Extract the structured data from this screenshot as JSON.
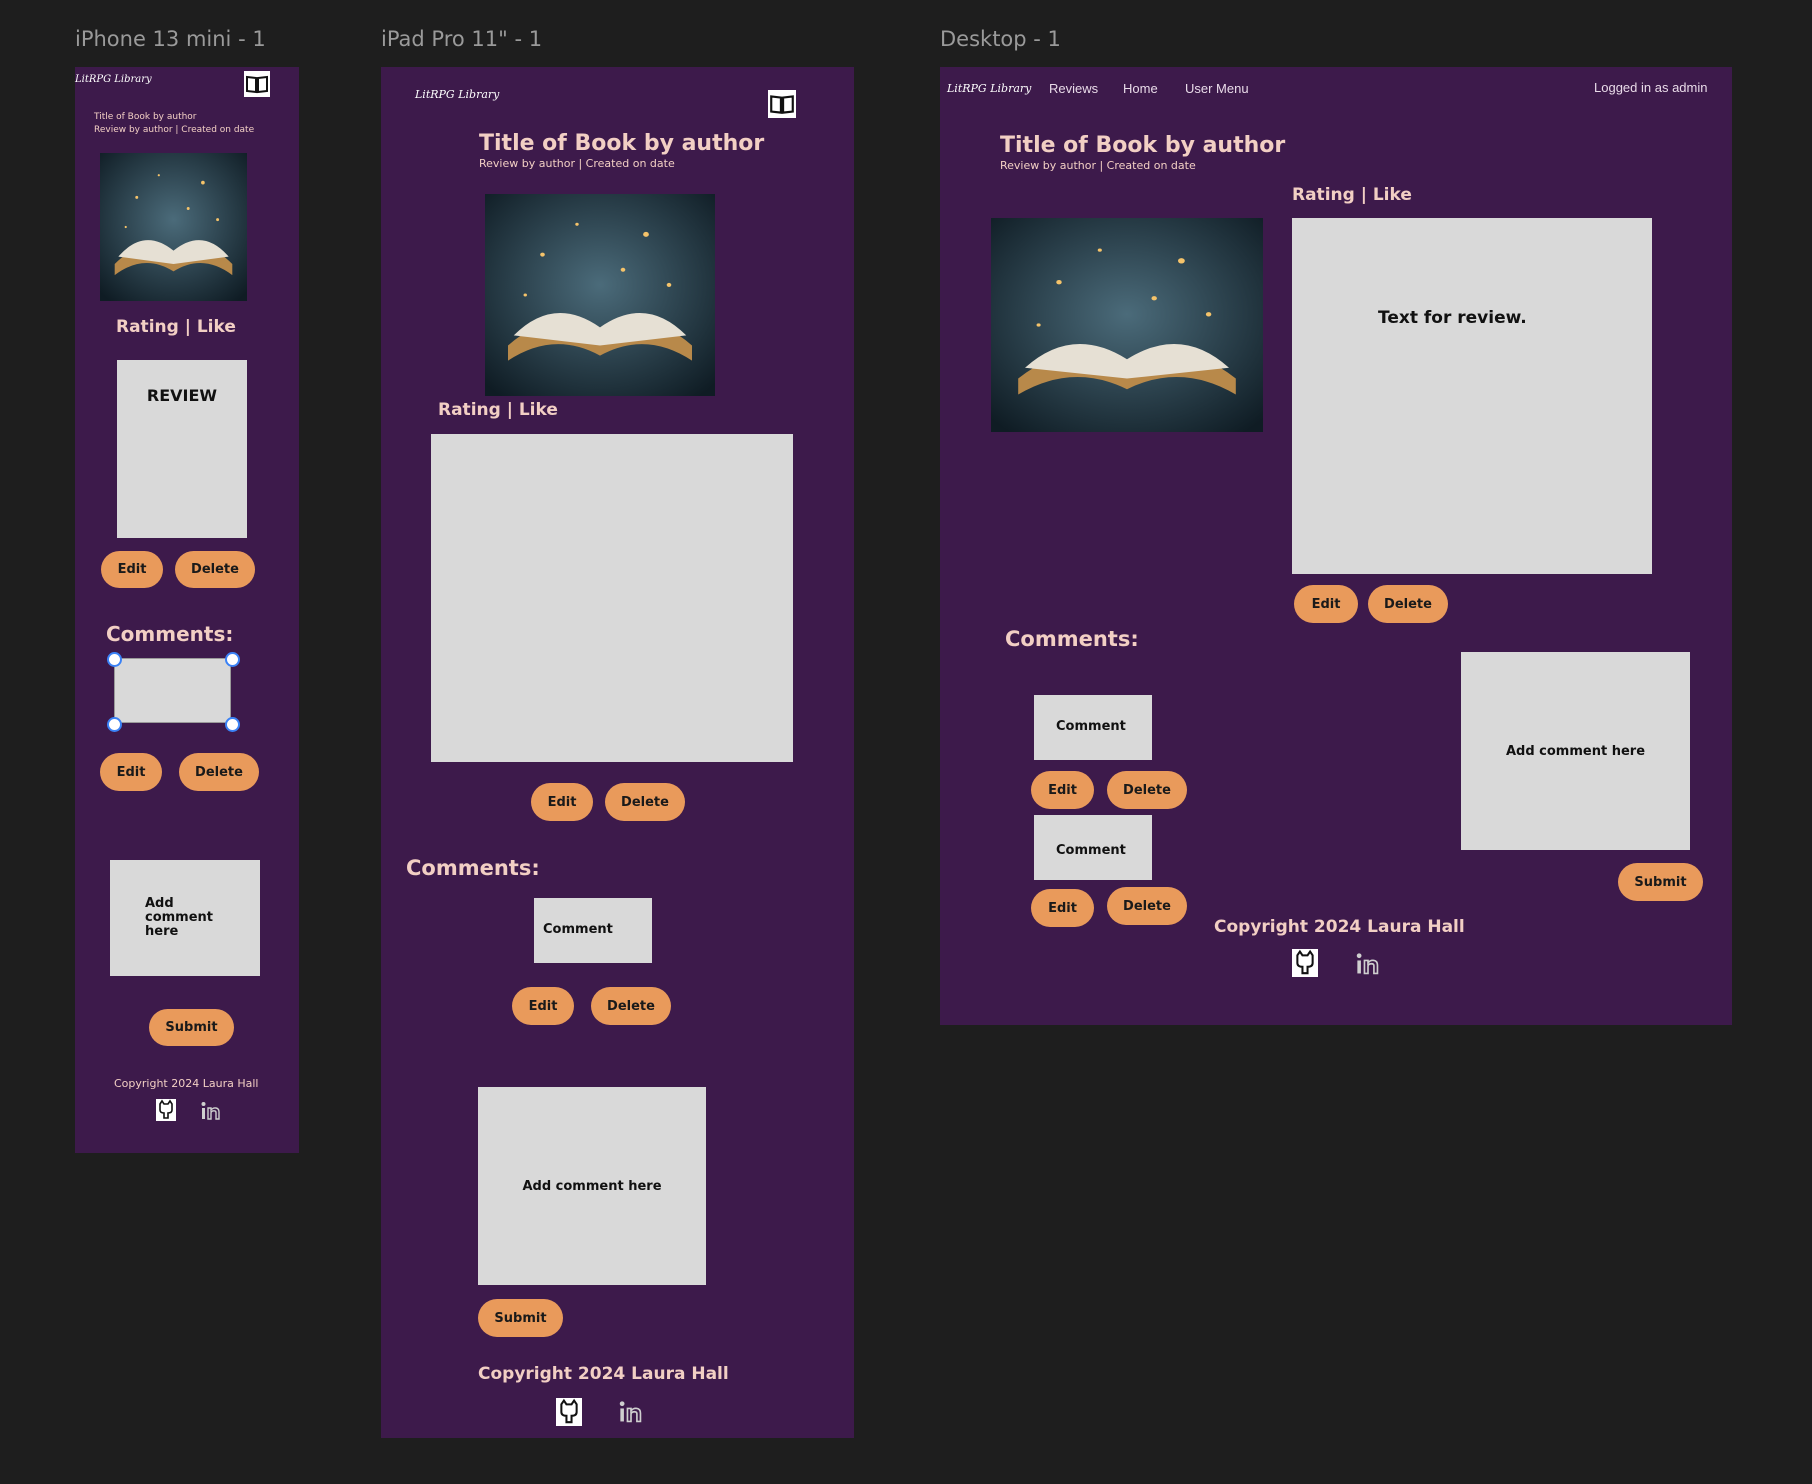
{
  "frames": {
    "mobile": "iPhone 13 mini - 1",
    "tablet": "iPad Pro 11\" - 1",
    "desktop": "Desktop - 1"
  },
  "site": {
    "logo": "LitRPG Library",
    "nav": [
      "Reviews",
      "Home",
      "User Menu"
    ],
    "logged_in": "Logged in as admin",
    "copyright": "Copyright 2024 Laura Hall"
  },
  "review": {
    "title": "Title of Book by author",
    "meta": "Review by author | Created on date",
    "rating_like": "Rating | Like",
    "mobile_review_text": "REVIEW",
    "desktop_review_text": "Text for review."
  },
  "comments": {
    "heading": "Comments:",
    "comment_text": "Comment",
    "add_placeholder": "Add comment here"
  },
  "buttons": {
    "edit": "Edit",
    "delete": "Delete",
    "submit": "Submit"
  },
  "icons": {
    "book": "book-open-icon",
    "github": "github-icon",
    "linkedin": "linkedin-icon"
  },
  "colors": {
    "canvas": "#1e1e1e",
    "frame": "#3d1a4b",
    "heading_text": "#f2cfc4",
    "button": "#e99a5b",
    "placeholder_box": "#d9d9d9"
  }
}
